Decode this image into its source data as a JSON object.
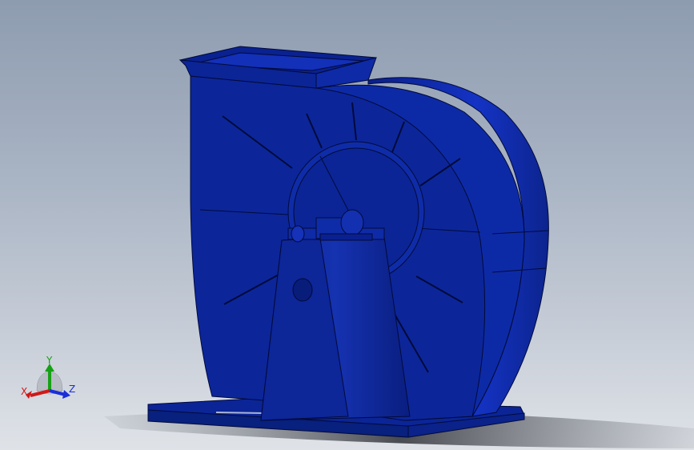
{
  "viewport": {
    "model": "centrifugal-fan",
    "model_color": "#0b2596",
    "edge_color": "#020a3a"
  },
  "triad": {
    "x_label": "X",
    "y_label": "Y",
    "z_label": "Z",
    "x_color": "#d01818",
    "y_color": "#16a016",
    "z_color": "#1a2ed8"
  }
}
